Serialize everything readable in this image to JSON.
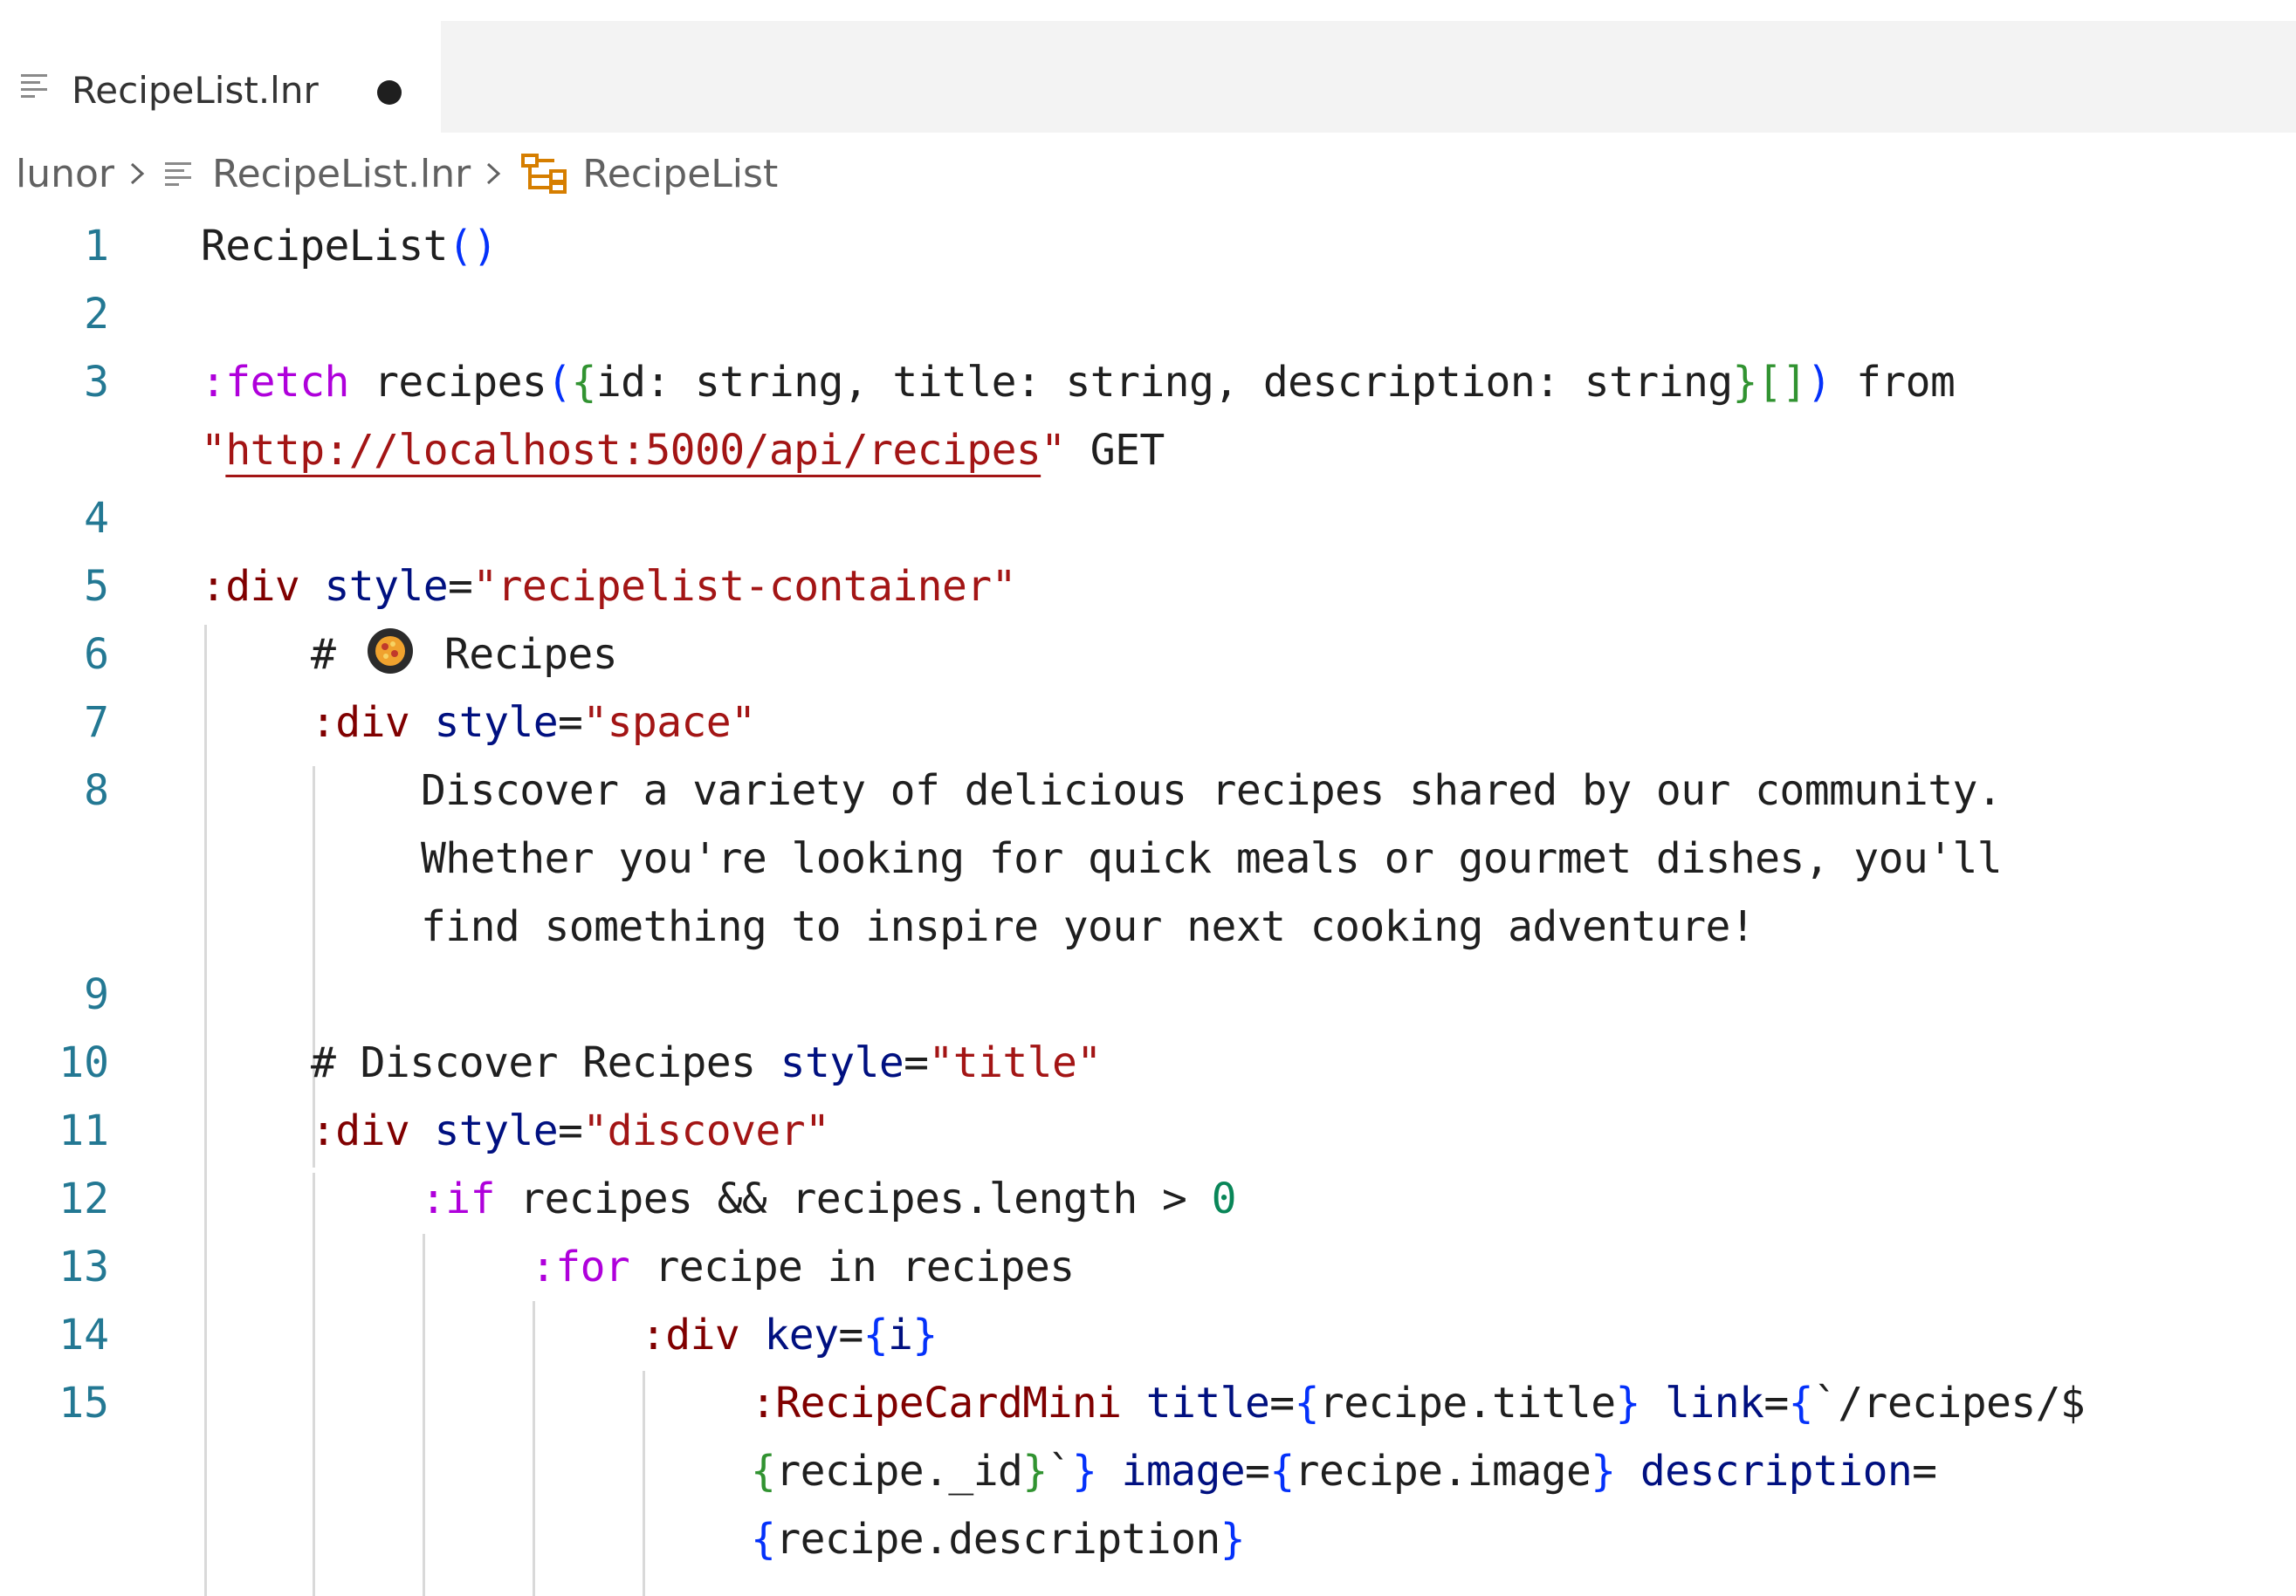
{
  "tab": {
    "label": "RecipeList.lnr",
    "dirty_indicator": "●"
  },
  "breadcrumb": {
    "root": "lunor",
    "file": "RecipeList.lnr",
    "symbol": "RecipeList"
  },
  "gutter": [
    "1",
    "2",
    "3",
    "",
    "4",
    "5",
    "6",
    "7",
    "8",
    "",
    "",
    "9",
    "10",
    "11",
    "12",
    "13",
    "14",
    "15",
    "",
    ""
  ],
  "code": {
    "l1": [
      "RecipeList",
      "()"
    ],
    "l3a": [
      ":fetch",
      " recipes",
      "(",
      "{",
      "id: string, title: string, description: string",
      "}",
      "[]",
      ")",
      " from"
    ],
    "l3b": [
      "\"",
      "http://localhost:5000/api/recipes",
      "\"",
      " GET"
    ],
    "l5": [
      ":div",
      " style",
      "=",
      "\"recipelist-container\""
    ],
    "l6": [
      "# ",
      " Recipes"
    ],
    "l7": [
      ":div",
      " style",
      "=",
      "\"space\""
    ],
    "l8a": "Discover a variety of delicious recipes shared by our community.",
    "l8b": "Whether you're looking for quick meals or gourmet dishes, you'll",
    "l8c": "find something to inspire your next cooking adventure!",
    "l10": [
      "# Discover Recipes ",
      "style",
      "=",
      "\"title\""
    ],
    "l11": [
      ":div",
      " style",
      "=",
      "\"discover\""
    ],
    "l12": [
      ":if",
      " recipes && recipes.length > ",
      "0"
    ],
    "l13": [
      ":for",
      " recipe in recipes"
    ],
    "l14": [
      ":div",
      " key",
      "=",
      "{",
      "i",
      "}"
    ],
    "l15a": [
      ":RecipeCardMini",
      " title",
      "=",
      "{",
      "recipe.title",
      "}",
      " link",
      "=",
      "{",
      "`/recipes/$"
    ],
    "l15b": [
      "{",
      "recipe._id",
      "}",
      "`",
      "}",
      " image",
      "=",
      "{",
      "recipe.image",
      "}",
      " description",
      "="
    ],
    "l15c": [
      "{",
      "recipe.description",
      "}"
    ]
  },
  "colors": {
    "keyword": "#af00db",
    "tag": "#800000",
    "attribute": "#001080",
    "string": "#a31515",
    "bracket1": "#0431fa",
    "bracket2": "#319331",
    "number": "#098658",
    "line_number": "#237893"
  },
  "icons": {
    "tab": "file-lines-icon",
    "crumb_file": "file-lines-icon",
    "crumb_symbol": "symbol-class-icon",
    "emoji": "cooking-pan-emoji"
  }
}
